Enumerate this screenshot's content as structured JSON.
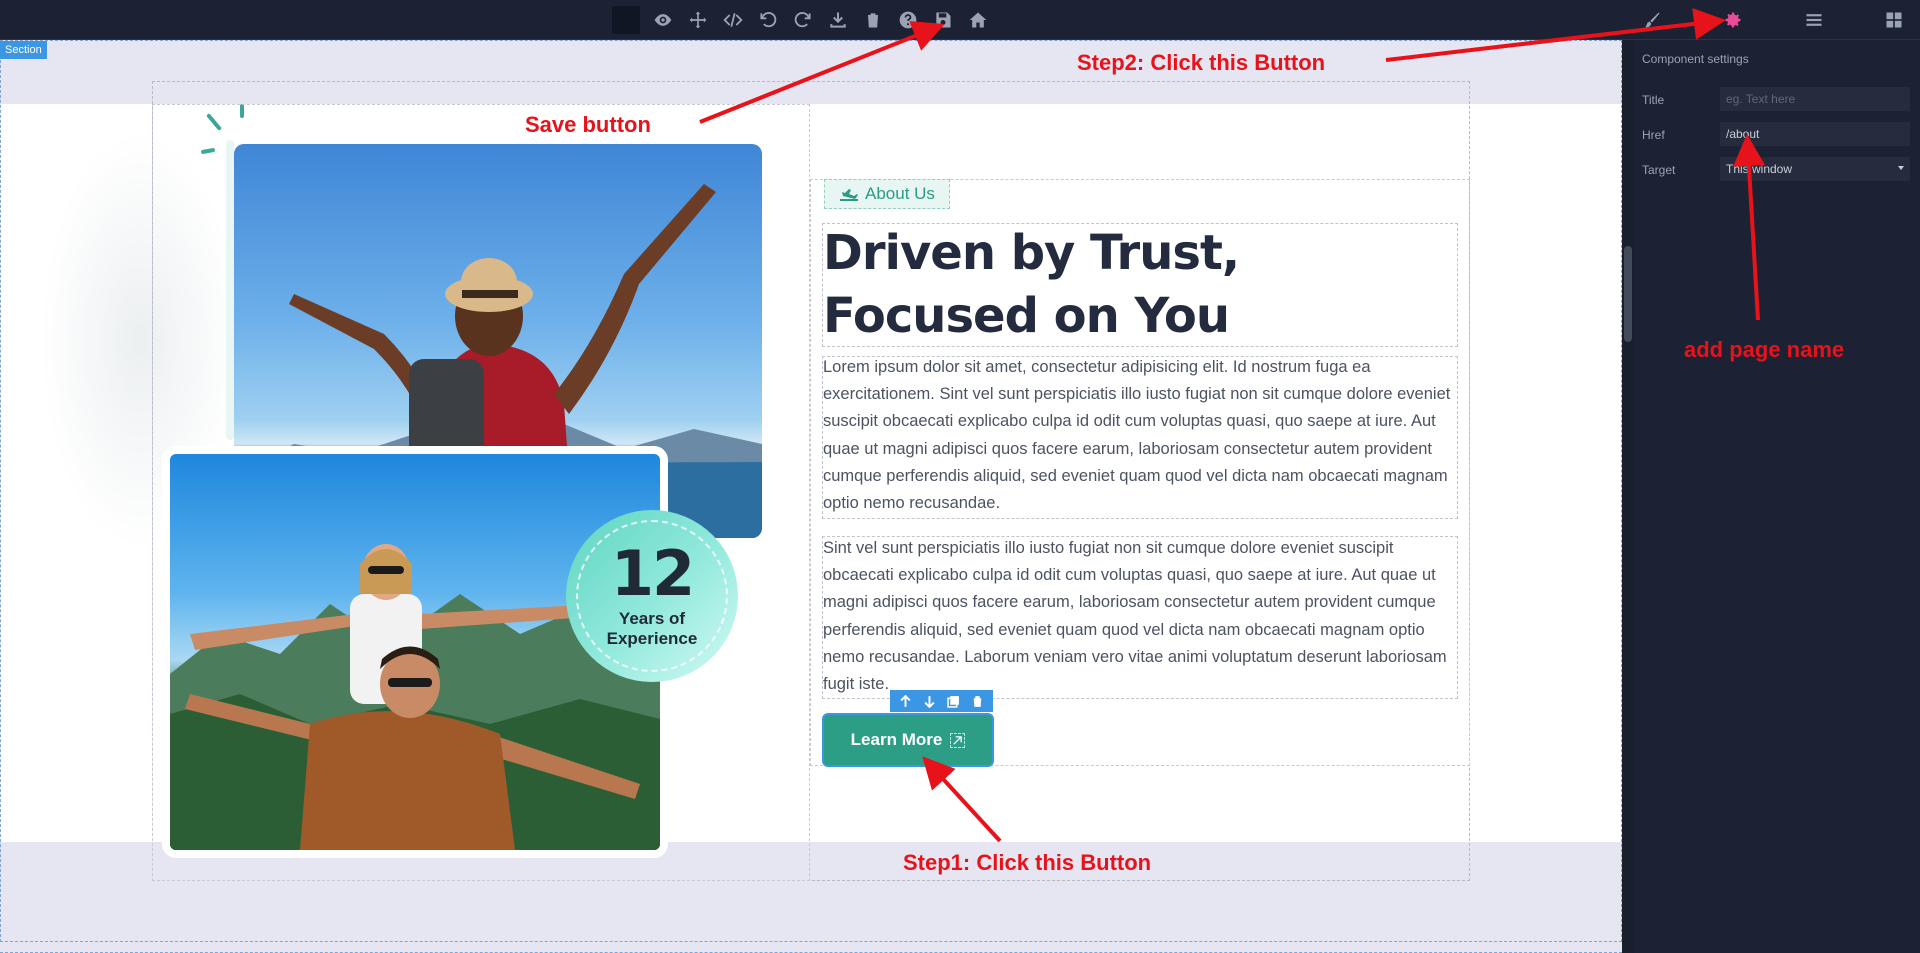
{
  "toolbar": {
    "icons": [
      "color-swatch",
      "eye-icon",
      "move-icon",
      "code-icon",
      "undo-icon",
      "redo-icon",
      "download-icon",
      "trash-icon",
      "help-icon",
      "save-icon",
      "home-icon"
    ],
    "right_icons": [
      "brush-icon",
      "gear-icon",
      "layers-icon",
      "blocks-icon"
    ],
    "active_color": "#e84a9c"
  },
  "canvas": {
    "section_label": "Section",
    "about_tag": "About Us",
    "heading": "Driven by Trust, Focused on You",
    "paragraph1": "Lorem ipsum dolor sit amet, consectetur adipisicing elit. Id nostrum fuga ea exercitationem. Sint vel sunt perspiciatis illo iusto fugiat non sit cumque dolore eveniet suscipit obcaecati explicabo culpa id odit cum voluptas quasi, quo saepe at iure. Aut quae ut magni adipisci quos facere earum, laboriosam consectetur autem provident cumque perferendis aliquid, sed eveniet quam quod vel dicta nam obcaecati magnam optio nemo recusandae.",
    "paragraph2": "Sint vel sunt perspiciatis illo iusto fugiat non sit cumque dolore eveniet suscipit obcaecati explicabo culpa id odit cum voluptas quasi, quo saepe at iure. Aut quae ut magni adipisci quos facere earum, laboriosam consectetur autem provident cumque perferendis aliquid, sed eveniet quam quod vel dicta nam obcaecati magnam optio nemo recusandae. Laborum veniam vero vitae animi voluptatum deserunt laboriosam fugit iste.",
    "badge_number": "12",
    "badge_text": "Years of Experience",
    "button_label": "Learn More",
    "accent": "#2d9e86"
  },
  "panel": {
    "title": "Component settings",
    "title_label": "Title",
    "title_placeholder": "eg. Text here",
    "href_label": "Href",
    "href_value": "/about",
    "target_label": "Target",
    "target_value": "This window"
  },
  "annotations": {
    "save": "Save button",
    "step2": "Step2: Click this Button",
    "page_name": "add page name",
    "step1": "Step1: Click this Button"
  }
}
